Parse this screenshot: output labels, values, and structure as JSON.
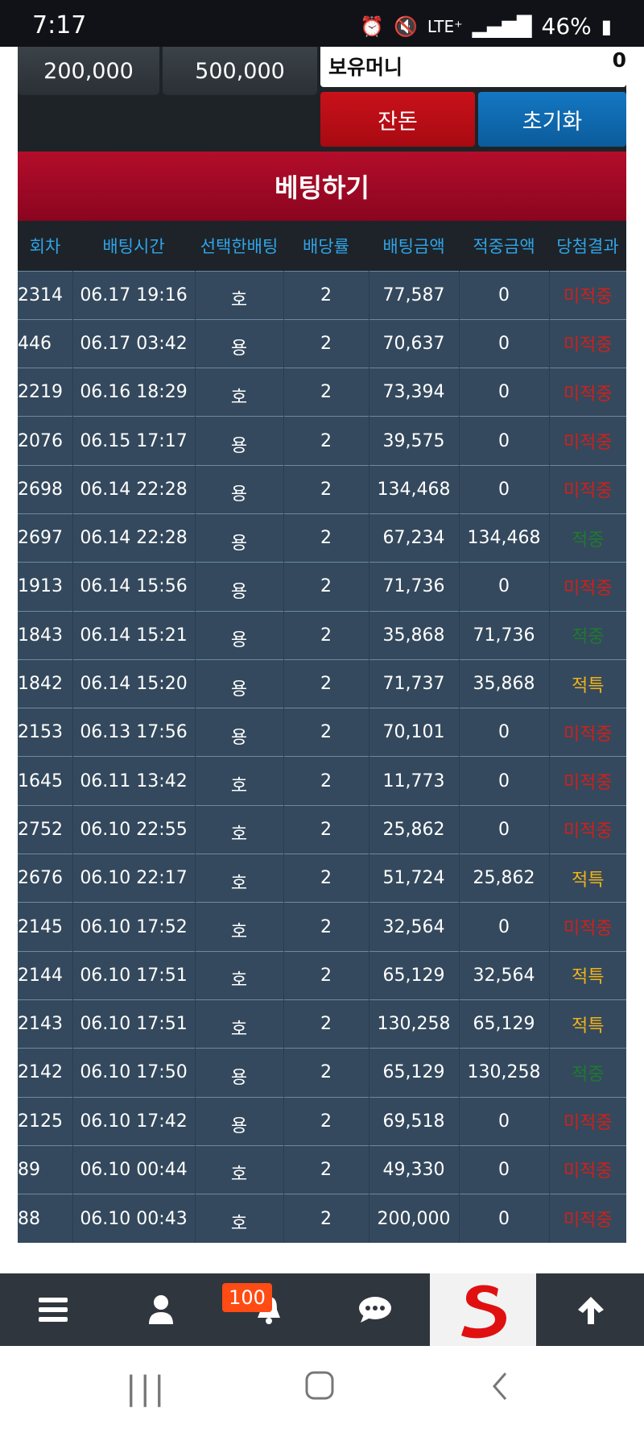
{
  "status_bar": {
    "time": "7:17",
    "network": "LTE⁺",
    "battery": "46%"
  },
  "top_panel": {
    "chip1": "200,000",
    "chip2": "500,000",
    "money_label": "보유머니",
    "money_value": "0",
    "btn_change": "잔돈",
    "btn_reset": "초기화"
  },
  "bet_title": "베팅하기",
  "table": {
    "headers": [
      "회차",
      "배팅시간",
      "선택한배팅",
      "배당률",
      "배팅금액",
      "적중금액",
      "당첨결과"
    ],
    "rows": [
      [
        "2314",
        "06.17 19:16",
        "호",
        "2",
        "77,587",
        "0",
        "미적중"
      ],
      [
        "446",
        "06.17 03:42",
        "용",
        "2",
        "70,637",
        "0",
        "미적중"
      ],
      [
        "2219",
        "06.16 18:29",
        "호",
        "2",
        "73,394",
        "0",
        "미적중"
      ],
      [
        "2076",
        "06.15 17:17",
        "용",
        "2",
        "39,575",
        "0",
        "미적중"
      ],
      [
        "2698",
        "06.14 22:28",
        "용",
        "2",
        "134,468",
        "0",
        "미적중"
      ],
      [
        "2697",
        "06.14 22:28",
        "용",
        "2",
        "67,234",
        "134,468",
        "적중"
      ],
      [
        "1913",
        "06.14 15:56",
        "용",
        "2",
        "71,736",
        "0",
        "미적중"
      ],
      [
        "1843",
        "06.14 15:21",
        "용",
        "2",
        "35,868",
        "71,736",
        "적중"
      ],
      [
        "1842",
        "06.14 15:20",
        "용",
        "2",
        "71,737",
        "35,868",
        "적특"
      ],
      [
        "2153",
        "06.13 17:56",
        "용",
        "2",
        "70,101",
        "0",
        "미적중"
      ],
      [
        "1645",
        "06.11 13:42",
        "호",
        "2",
        "11,773",
        "0",
        "미적중"
      ],
      [
        "2752",
        "06.10 22:55",
        "호",
        "2",
        "25,862",
        "0",
        "미적중"
      ],
      [
        "2676",
        "06.10 22:17",
        "호",
        "2",
        "51,724",
        "25,862",
        "적특"
      ],
      [
        "2145",
        "06.10 17:52",
        "호",
        "2",
        "32,564",
        "0",
        "미적중"
      ],
      [
        "2144",
        "06.10 17:51",
        "호",
        "2",
        "65,129",
        "32,564",
        "적특"
      ],
      [
        "2143",
        "06.10 17:51",
        "호",
        "2",
        "130,258",
        "65,129",
        "적특"
      ],
      [
        "2142",
        "06.10 17:50",
        "용",
        "2",
        "65,129",
        "130,258",
        "적중"
      ],
      [
        "2125",
        "06.10 17:42",
        "용",
        "2",
        "69,518",
        "0",
        "미적중"
      ],
      [
        "89",
        "06.10 00:44",
        "호",
        "2",
        "49,330",
        "0",
        "미적중"
      ],
      [
        "88",
        "06.10 00:43",
        "호",
        "2",
        "200,000",
        "0",
        "미적중"
      ]
    ]
  },
  "bottom_nav": {
    "badge": "100",
    "items": [
      "menu-icon",
      "user-icon",
      "bell-icon",
      "chat-icon",
      "logo",
      "arrow-up-icon"
    ]
  },
  "colors": {
    "lose": "#d0201a",
    "win": "#1e7a2e",
    "special": "#f0b21a",
    "header_text": "#31a4e8",
    "row_bg": "#34495d"
  }
}
